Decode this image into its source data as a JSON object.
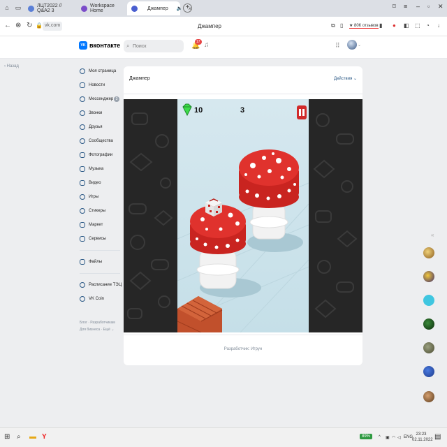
{
  "browser": {
    "tabs": [
      {
        "label": "ЛЦТ2022 // Q&A2 3",
        "active": false,
        "color": "#5a7fd6"
      },
      {
        "label": "Workspace Home",
        "active": false,
        "color": "#7b4cc9"
      },
      {
        "label": "Джампер",
        "active": true,
        "color": "#4a5fd0"
      }
    ],
    "url": "vk.com",
    "page_title": "Джампер",
    "reviews_badge": "★ 80К отзывов"
  },
  "vk": {
    "logo_text": "VK",
    "brand_name": "вконтакте",
    "search_placeholder": "Поиск",
    "notifications_count": "17",
    "accent_color": "#0077ff"
  },
  "left": {
    "back_label": "Назад",
    "nav": [
      {
        "label": "Моя страница",
        "icon": "user-icon"
      },
      {
        "label": "Новости",
        "icon": "news-icon"
      },
      {
        "label": "Мессенджер",
        "icon": "message-icon",
        "count": "3"
      },
      {
        "label": "Звонки",
        "icon": "phone-icon"
      },
      {
        "label": "Друзья",
        "icon": "friends-icon"
      },
      {
        "label": "Сообщества",
        "icon": "groups-icon"
      },
      {
        "label": "Фотографии",
        "icon": "photo-icon"
      },
      {
        "label": "Музыка",
        "icon": "music-icon"
      },
      {
        "label": "Видео",
        "icon": "video-icon"
      },
      {
        "label": "Игры",
        "icon": "games-icon"
      },
      {
        "label": "Стикеры",
        "icon": "sticker-icon"
      },
      {
        "label": "Маркет",
        "icon": "market-icon"
      },
      {
        "label": "Сервисы",
        "icon": "services-icon"
      }
    ],
    "nav2": [
      {
        "label": "Файлы",
        "icon": "file-icon"
      }
    ],
    "nav3": [
      {
        "label": "Расписание ТЭЦ",
        "icon": "schedule-icon"
      },
      {
        "label": "VK Coin",
        "icon": "coin-icon"
      }
    ],
    "footer_line1": "Блог · Разработчикам",
    "footer_line2": "Для бизнеса · Ещё ⌄"
  },
  "card": {
    "title": "Джампер",
    "actions_label": "Действия ⌄",
    "developer_line": "Разработчик: Игрун"
  },
  "game": {
    "gems": "10",
    "score": "3",
    "gem_color": "#3ddc4a",
    "mushroom_color": "#e0322d",
    "pause_color": "#d12a2a"
  },
  "taskbar": {
    "battery": "89%",
    "language": "ENG",
    "time": "23:23",
    "date": "02.11.2022"
  }
}
